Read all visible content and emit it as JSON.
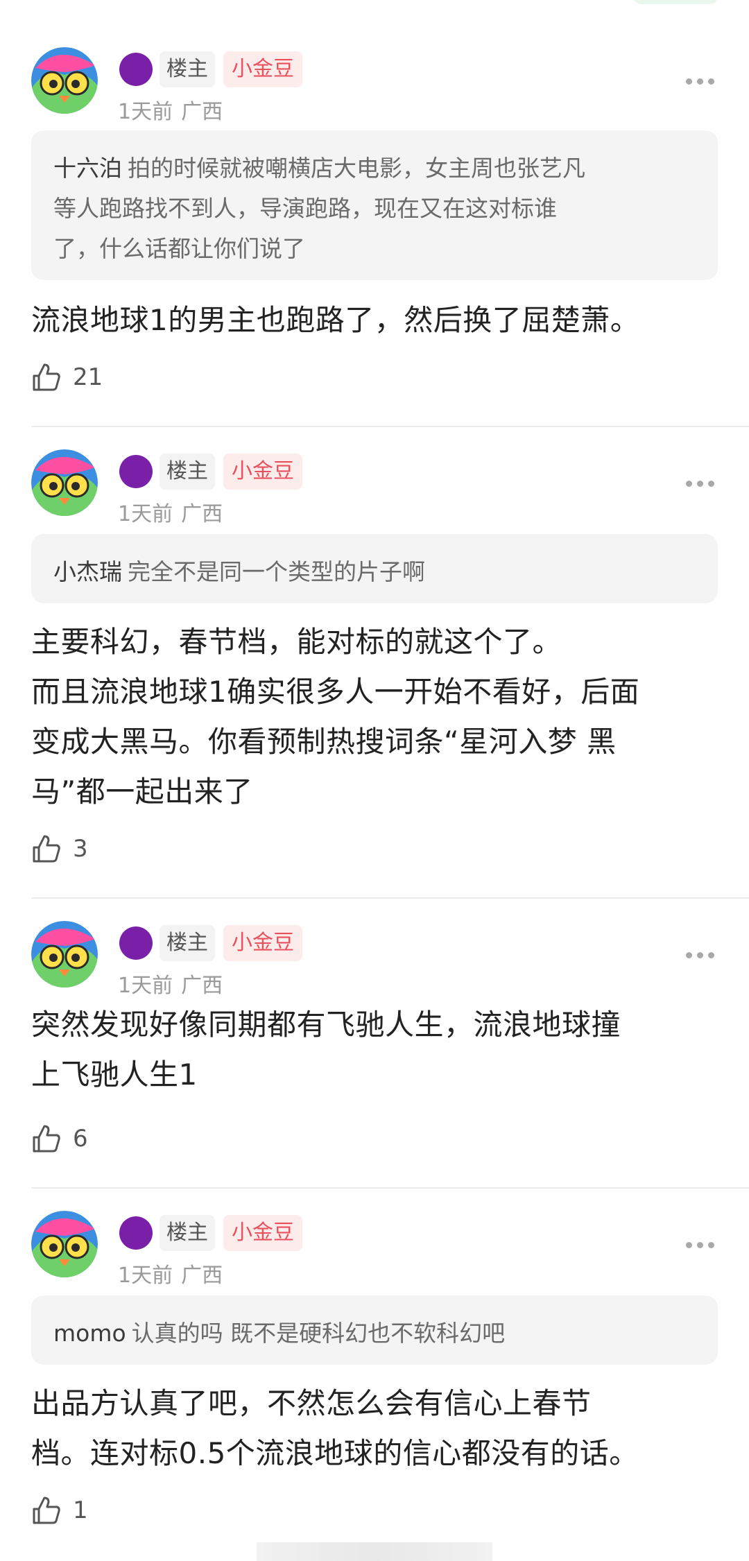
{
  "comments": [
    {
      "owner_tag": "楼主",
      "level_tag": "小金豆",
      "time": "1天前",
      "location": "广西",
      "quote_name": "十六泊",
      "quote_lines": [
        "拍的时候就被嘲横店大电影，女主周也张艺凡",
        "等人跑路找不到人，导演跑路，现在又在这对标谁",
        "了，什么话都让你们说了"
      ],
      "content_lines": [
        "流浪地球1的男主也跑路了，然后换了屈楚萧。"
      ],
      "likes": "21"
    },
    {
      "owner_tag": "楼主",
      "level_tag": "小金豆",
      "time": "1天前",
      "location": "广西",
      "quote_name": "小杰瑞",
      "quote_lines": [
        "完全不是同一个类型的片子啊"
      ],
      "content_lines": [
        "主要科幻，春节档，能对标的就这个了。",
        "而且流浪地球1确实很多人一开始不看好，后面",
        "变成大黑马。你看预制热搜词条“星河入梦  黑",
        "马”都一起出来了"
      ],
      "likes": "3"
    },
    {
      "owner_tag": "楼主",
      "level_tag": "小金豆",
      "time": "1天前",
      "location": "广西",
      "content_lines": [
        "突然发现好像同期都有飞驰人生，流浪地球撞",
        "上飞驰人生1"
      ],
      "likes": "6"
    },
    {
      "owner_tag": "楼主",
      "level_tag": "小金豆",
      "time": "1天前",
      "location": "广西",
      "quote_name": "momo",
      "quote_lines": [
        "认真的吗 既不是硬科幻也不软科幻吧"
      ],
      "content_lines": [
        "出品方认真了吧，不然怎么会有信心上春节",
        "档。连对标0.5个流浪地球的信心都没有的话。"
      ],
      "likes": "1"
    }
  ],
  "icons": {
    "avatar": "cartoon-bird-avatar-icon",
    "level": "purple-level-dot-icon",
    "more": "more-dots-icon",
    "like": "thumbs-up-icon"
  },
  "colors": {
    "gold_tag_text": "#e8505b",
    "gold_tag_bg": "#fdecec",
    "level_dot": "#7a1fa8",
    "quote_bg": "#f4f4f4"
  }
}
